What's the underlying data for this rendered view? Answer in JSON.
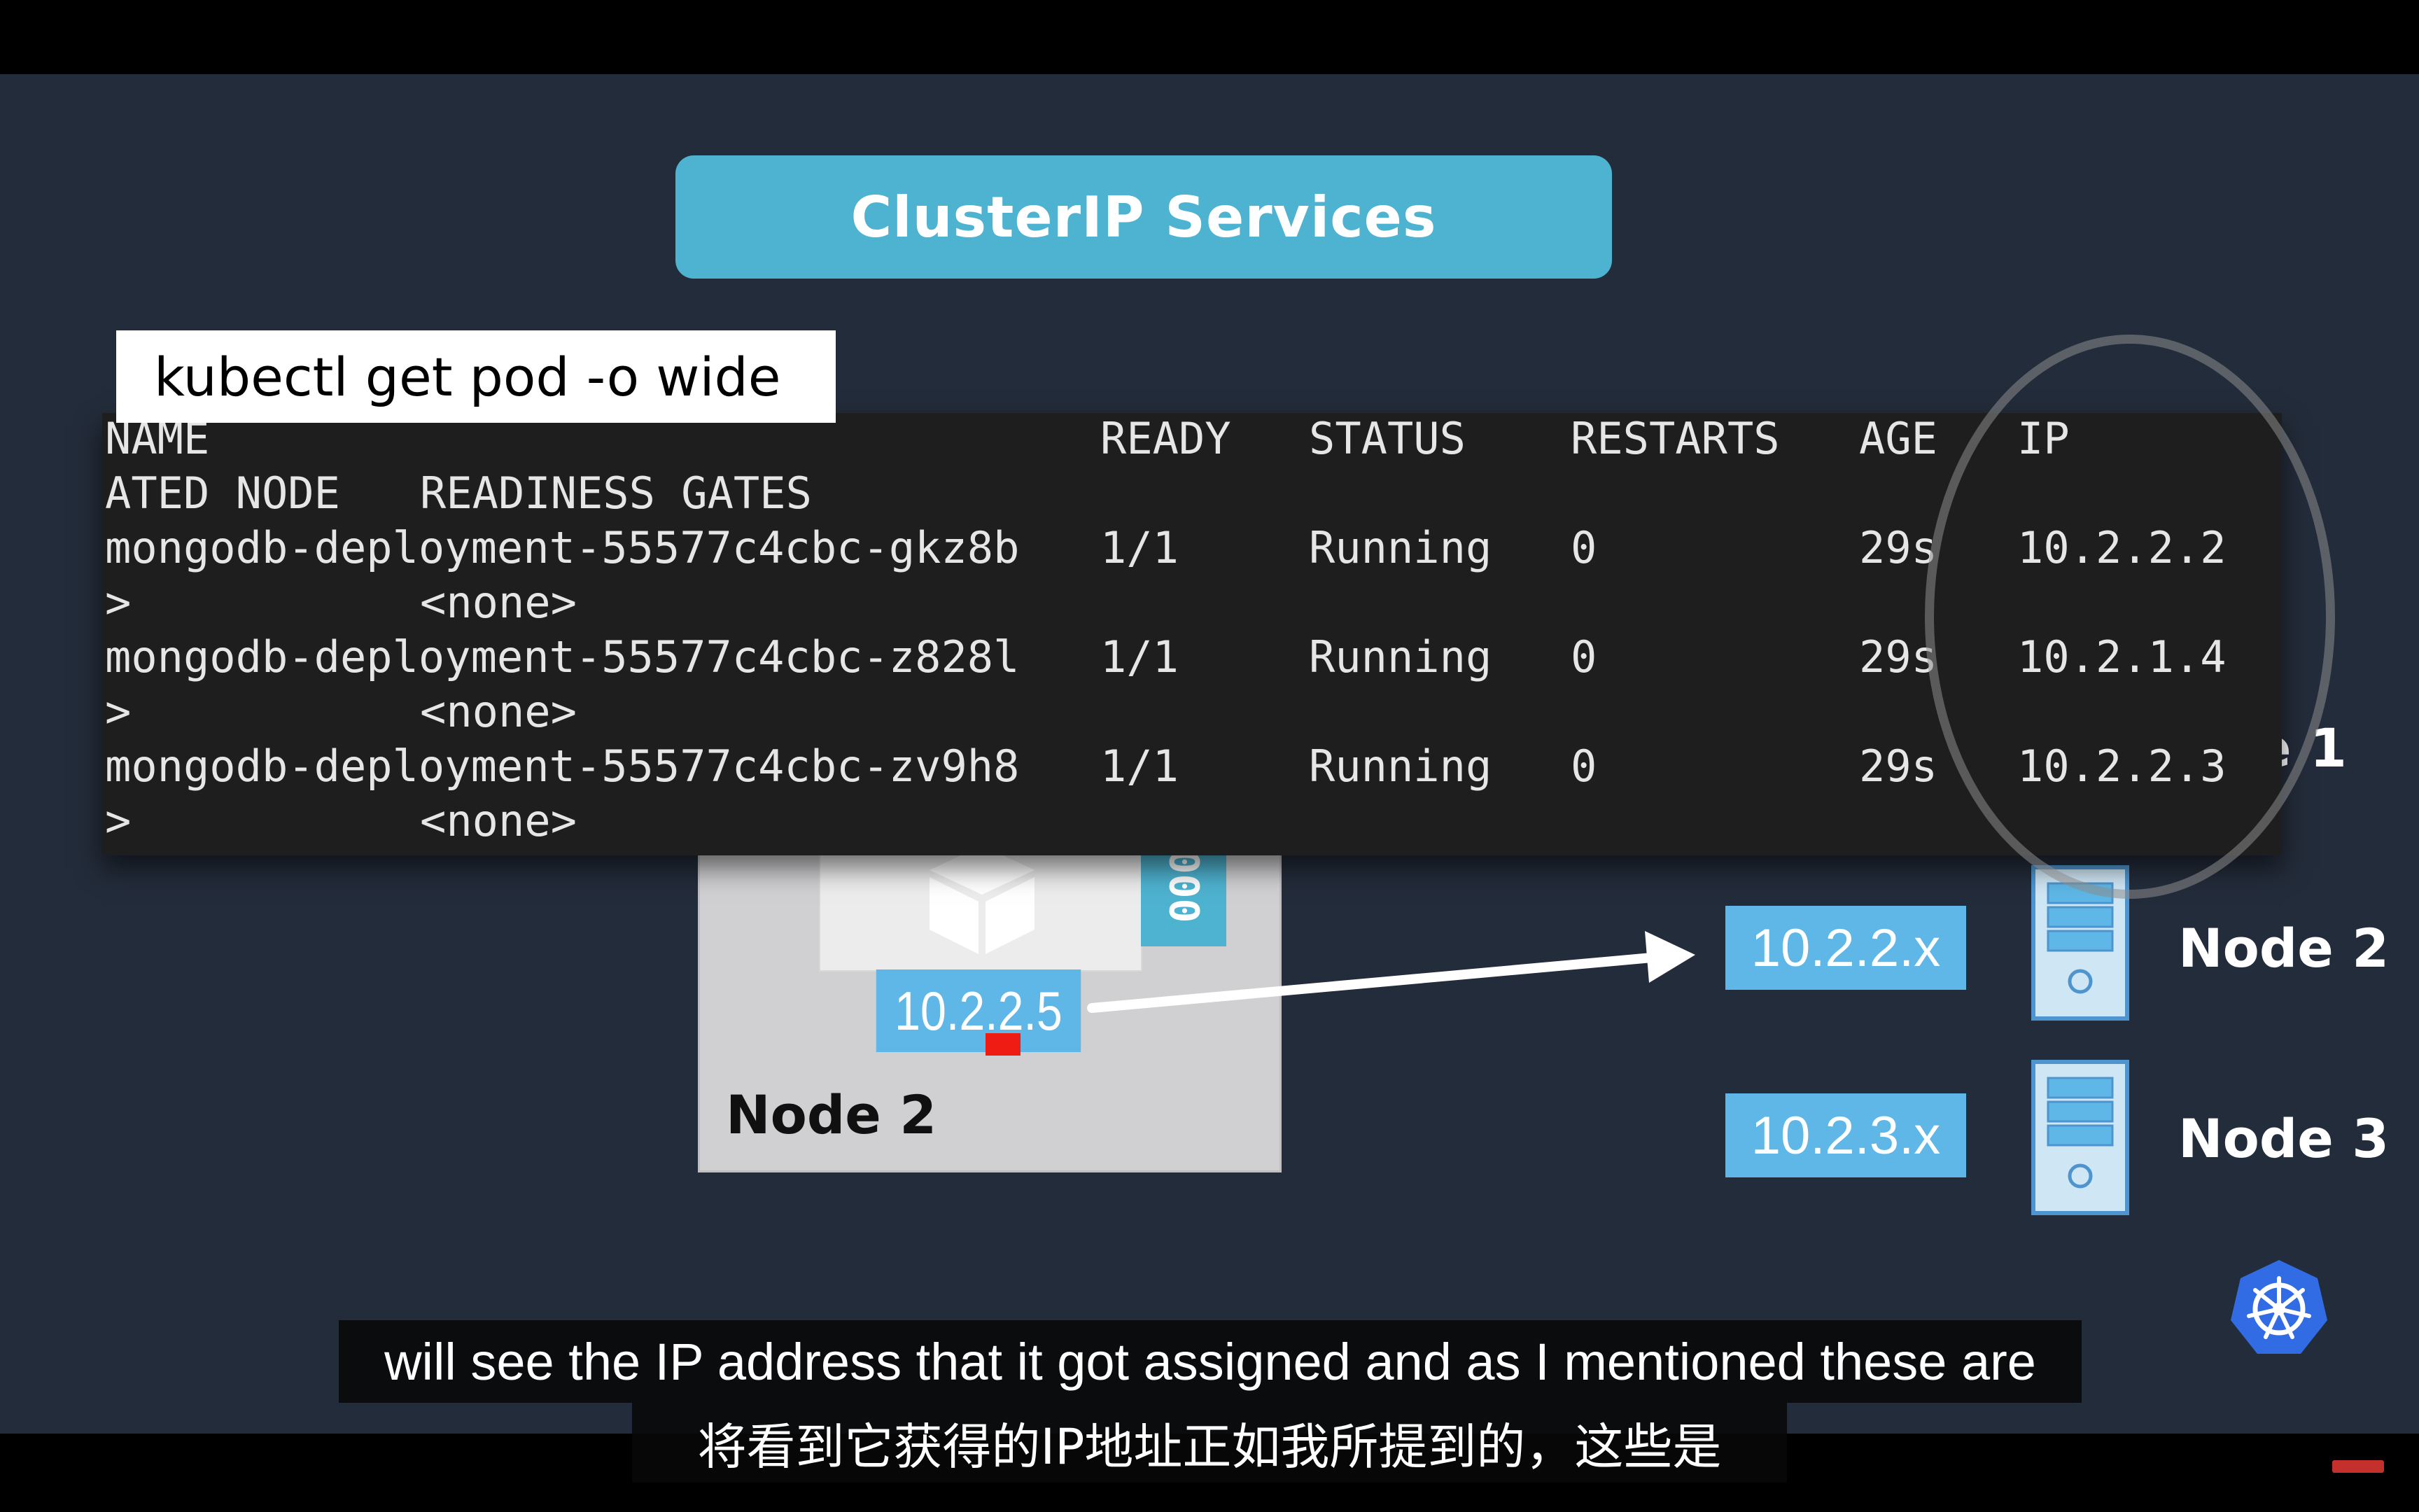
{
  "slide": {
    "title": "ClusterIP Services"
  },
  "command": "kubectl get pod -o wide",
  "terminal": {
    "header": {
      "name": "NAME",
      "ready": "READY",
      "status": "STATUS",
      "restarts": "RESTARTS",
      "age": "AGE",
      "ip": "IP"
    },
    "header_line2": {
      "nominated_node": "ATED NODE",
      "readiness_gates": "READINESS GATES"
    },
    "pods": [
      {
        "name": "mongodb-deployment-55577c4cbc-gkz8b",
        "ready": "1/1",
        "status": "Running",
        "restarts": "0",
        "age": "29s",
        "ip": "10.2.2.2",
        "cont_prefix": ">",
        "readiness": "<none>"
      },
      {
        "name": "mongodb-deployment-55577c4cbc-z828l",
        "ready": "1/1",
        "status": "Running",
        "restarts": "0",
        "age": "29s",
        "ip": "10.2.1.4",
        "cont_prefix": ">",
        "readiness": "<none>"
      },
      {
        "name": "mongodb-deployment-55577c4cbc-zv9h8",
        "ready": "1/1",
        "status": "Running",
        "restarts": "0",
        "age": "29s",
        "ip": "10.2.2.3",
        "cont_prefix": ">",
        "readiness": "<none>"
      }
    ]
  },
  "diagram": {
    "pod_ip": "10.2.2.5",
    "pod_port": "000",
    "left_node_label": "Node 2",
    "node1_partial_label": "le 1",
    "nodes": [
      {
        "subnet": "10.2.2.x",
        "label": "Node 2"
      },
      {
        "subnet": "10.2.3.x",
        "label": "Node 3"
      }
    ]
  },
  "subtitles": {
    "english": "will see the IP address that it got assigned and as I mentioned these are",
    "chinese": "将看到它获得的IP地址正如我所提到的，这些是"
  },
  "icons": {
    "logo": "kubernetes-logo-icon",
    "server": "server-icon",
    "pod": "pod-cube-icon"
  },
  "colors": {
    "background": "#232c3a",
    "accent": "#4eb3d0",
    "ip_box": "#5eb7e6",
    "terminal_bg": "#1e1e1e",
    "marker": "#ee1c12"
  }
}
